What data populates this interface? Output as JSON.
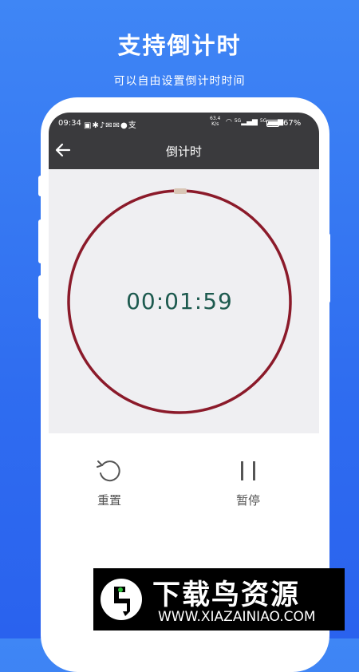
{
  "hero": {
    "title": "支持倒计时",
    "subtitle": "可以自由设置倒计时时间"
  },
  "status_bar": {
    "time": "09:34",
    "left_icons": [
      "notification-icon",
      "bluetooth-icon",
      "mute-bell-icon",
      "mail-icon",
      "mail-icon",
      "browser-icon",
      "alipay-icon"
    ],
    "net_speed_value": "63.4",
    "net_speed_unit": "K/s",
    "signal_1": "5G",
    "signal_2": "5G",
    "battery_percent": "67%",
    "battery_level": 0.67
  },
  "app_bar": {
    "title": "倒计时",
    "back_icon": "arrow-left-icon"
  },
  "timer": {
    "remaining": "00:01:59",
    "ring_color": "#8b1a2a"
  },
  "controls": {
    "reset_label": "重置",
    "reset_icon": "restart-icon",
    "pause_label": "暂停",
    "pause_icon": "pause-icon"
  },
  "watermark": {
    "main": "下载鸟资源",
    "url": "WWW.XIAZAINIAO.COM"
  },
  "colors": {
    "background": "#3479f4",
    "bar": "#3a3a3d",
    "timer_text": "#1d5a4f"
  }
}
